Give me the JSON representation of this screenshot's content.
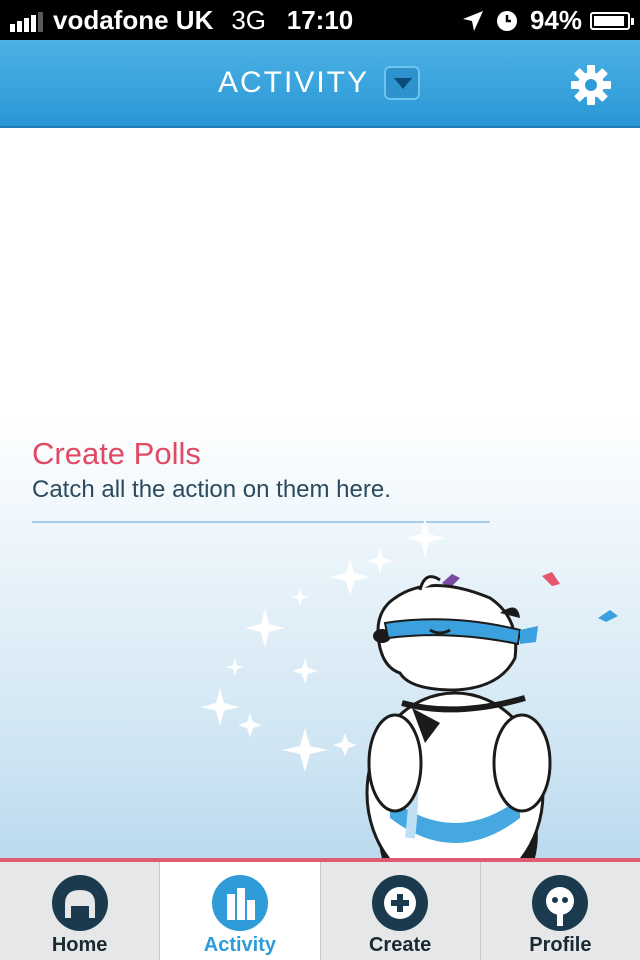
{
  "status_bar": {
    "carrier": "vodafone UK",
    "network": "3G",
    "time": "17:10",
    "battery": "94%",
    "battery_level": 0.94,
    "icons": [
      "signal-bars-icon",
      "location-arrow-icon",
      "clock-icon",
      "battery-icon"
    ]
  },
  "header": {
    "title": "ACTIVITY",
    "dropdown_icon": "chevron-down-icon",
    "settings_icon": "gear-icon"
  },
  "empty_state": {
    "title": "Create Polls",
    "subtitle": "Catch all the action on them here.",
    "illustration": "polar-bear-superhero-icon"
  },
  "tabbar": {
    "active": "Activity",
    "tabs": [
      {
        "label": "Home",
        "icon": "home-arch-icon"
      },
      {
        "label": "Activity",
        "icon": "activity-bars-icon"
      },
      {
        "label": "Create",
        "icon": "plus-circle-icon"
      },
      {
        "label": "Profile",
        "icon": "profile-face-icon"
      }
    ]
  },
  "colors": {
    "header_blue": "#2a97d6",
    "accent_pink": "#e04a64",
    "active_tab": "#2f9bd8",
    "tab_icon_dark": "#1c3a4e"
  }
}
